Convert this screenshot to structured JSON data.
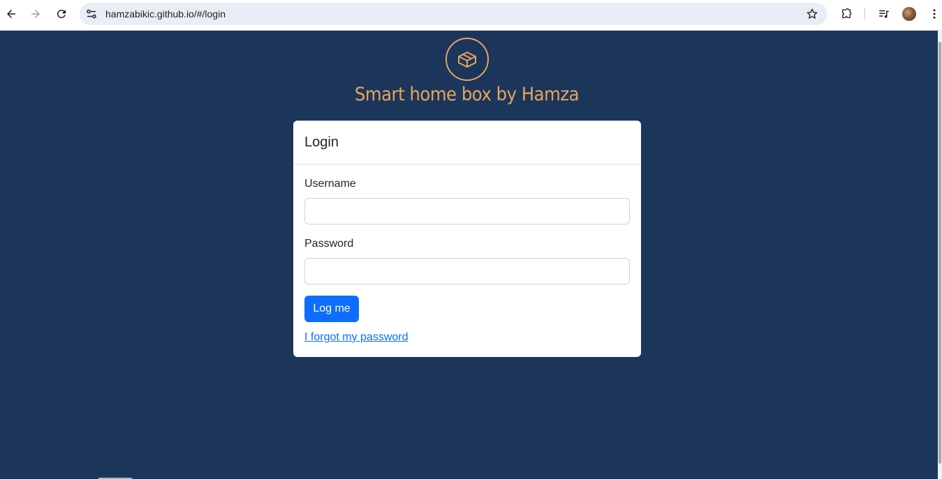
{
  "browser": {
    "url": "hamzabikic.github.io/#/login"
  },
  "brand": {
    "title": "Smart home box by Hamza",
    "accent_color": "#e4a659",
    "background_color": "#1c355b"
  },
  "login": {
    "title": "Login",
    "username_label": "Username",
    "username_value": "",
    "password_label": "Password",
    "password_value": "",
    "submit_label": "Log me",
    "forgot_link": "I forgot my password",
    "button_color": "#0d6efd"
  }
}
